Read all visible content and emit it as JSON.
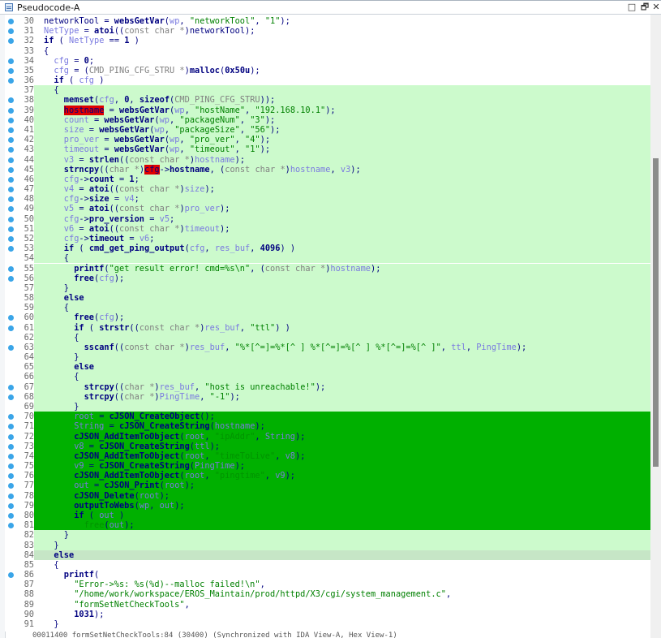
{
  "window": {
    "title": "Pseudocode-A",
    "buttons": {
      "maximize": "□",
      "restore": "🗗",
      "close": "✕"
    }
  },
  "colors": {
    "breakpoint": "#3aa5e8",
    "highlight_light": "#ccfacc",
    "highlight_dark": "#00b000",
    "highlight_else": "#c6e6c6",
    "marker_red": "#e00000"
  },
  "lines": [
    {
      "num": "30",
      "bp": true,
      "hl": "",
      "html": "networkTool = <span class='f'>websGetVar</span>(<span class='v'>wp</span>, <span class='s'>\"networkTool\"</span>, <span class='s'>\"1\"</span>);",
      "indent": 0
    },
    {
      "num": "31",
      "bp": true,
      "hl": "",
      "html": "<span class='v'>NetType</span> = <span class='f'>atoi</span>((<span class='t'>const char *</span>)networkTool);",
      "indent": 0
    },
    {
      "num": "32",
      "bp": true,
      "hl": "",
      "html": "<span class='k'>if</span> ( <span class='v'>NetType</span> == <span class='n'>1</span> )",
      "indent": 0
    },
    {
      "num": "33",
      "bp": false,
      "hl": "",
      "html": "{",
      "indent": 0
    },
    {
      "num": "34",
      "bp": true,
      "hl": "",
      "html": "<span class='v'>cfg</span> = <span class='n'>0</span>;",
      "indent": 1
    },
    {
      "num": "35",
      "bp": true,
      "hl": "",
      "html": "<span class='v'>cfg</span> = (<span class='t'>CMD_PING_CFG_STRU *</span>)<span class='f'>malloc</span>(<span class='n'>0x50u</span>);",
      "indent": 1
    },
    {
      "num": "36",
      "bp": true,
      "hl": "",
      "html": "<span class='k'>if</span> ( <span class='v'>cfg</span> )",
      "indent": 1
    },
    {
      "num": "37",
      "bp": false,
      "hl": "light",
      "html": "{",
      "indent": 1
    },
    {
      "num": "38",
      "bp": true,
      "hl": "light",
      "html": "<span class='f'>memset</span>(<span class='v'>cfg</span>, <span class='n'>0</span>, <span class='k'>sizeof</span>(<span class='t'>CMD_PING_CFG_STRU</span>));",
      "indent": 2
    },
    {
      "num": "39",
      "bp": true,
      "hl": "light",
      "html": "<span class='red'>hostname</span> = <span class='f'>websGetVar</span>(<span class='v'>wp</span>, <span class='s'>\"hostName\"</span>, <span class='s'>\"192.168.10.1\"</span>);",
      "indent": 2
    },
    {
      "num": "40",
      "bp": true,
      "hl": "light",
      "html": "<span class='v'>count</span> = <span class='f'>websGetVar</span>(<span class='v'>wp</span>, <span class='s'>\"packageNum\"</span>, <span class='s'>\"3\"</span>);",
      "indent": 2
    },
    {
      "num": "41",
      "bp": true,
      "hl": "light",
      "html": "<span class='v'>size</span> = <span class='f'>websGetVar</span>(<span class='v'>wp</span>, <span class='s'>\"packageSize\"</span>, <span class='s'>\"56\"</span>);",
      "indent": 2
    },
    {
      "num": "42",
      "bp": true,
      "hl": "light",
      "html": "<span class='v'>pro_ver</span> = <span class='f'>websGetVar</span>(<span class='v'>wp</span>, <span class='s'>\"pro_ver\"</span>, <span class='s'>\"4\"</span>);",
      "indent": 2
    },
    {
      "num": "43",
      "bp": true,
      "hl": "light",
      "html": "<span class='v'>timeout</span> = <span class='f'>websGetVar</span>(<span class='v'>wp</span>, <span class='s'>\"timeout\"</span>, <span class='s'>\"1\"</span>);",
      "indent": 2
    },
    {
      "num": "44",
      "bp": true,
      "hl": "light",
      "html": "<span class='v'>v3</span> = <span class='f'>strlen</span>((<span class='t'>const char *</span>)<span class='v'>hostname</span>);",
      "indent": 2
    },
    {
      "num": "45",
      "bp": true,
      "hl": "light",
      "html": "<span class='f'>strncpy</span>((<span class='t'>char *</span>)<span class='red'>cfg</span>-><span class='n'>hostname</span>, (<span class='t'>const char *</span>)<span class='v'>hostname</span>, <span class='v'>v3</span>);",
      "indent": 2
    },
    {
      "num": "46",
      "bp": true,
      "hl": "light",
      "html": "<span class='v'>cfg</span>-><span class='n'>count</span> = <span class='n'>1</span>;",
      "indent": 2
    },
    {
      "num": "47",
      "bp": true,
      "hl": "light",
      "html": "<span class='v'>v4</span> = <span class='f'>atoi</span>((<span class='t'>const char *</span>)<span class='v'>size</span>);",
      "indent": 2
    },
    {
      "num": "48",
      "bp": true,
      "hl": "light",
      "html": "<span class='v'>cfg</span>-><span class='n'>size</span> = <span class='v'>v4</span>;",
      "indent": 2
    },
    {
      "num": "49",
      "bp": true,
      "hl": "light",
      "html": "<span class='v'>v5</span> = <span class='f'>atoi</span>((<span class='t'>const char *</span>)<span class='v'>pro_ver</span>);",
      "indent": 2
    },
    {
      "num": "50",
      "bp": true,
      "hl": "light",
      "html": "<span class='v'>cfg</span>-><span class='n'>pro_version</span> = <span class='v'>v5</span>;",
      "indent": 2
    },
    {
      "num": "51",
      "bp": true,
      "hl": "light",
      "html": "<span class='v'>v6</span> = <span class='f'>atoi</span>((<span class='t'>const char *</span>)<span class='v'>timeout</span>);",
      "indent": 2
    },
    {
      "num": "52",
      "bp": true,
      "hl": "light",
      "html": "<span class='v'>cfg</span>-><span class='n'>timeout</span> = <span class='v'>v6</span>;",
      "indent": 2
    },
    {
      "num": "53",
      "bp": true,
      "hl": "light",
      "html": "<span class='k'>if</span> ( <span class='f'>cmd_get_ping_output</span>(<span class='v'>cfg</span>, <span class='v'>res_buf</span>, <span class='n'>4096</span>) )",
      "indent": 2
    },
    {
      "num": "54",
      "bp": false,
      "hl": "light",
      "html": "{",
      "indent": 2
    },
    {
      "num": "55",
      "bp": true,
      "hl": "light",
      "html": "<span class='f'>printf</span>(<span class='s'>\"get result error! cmd=%s\\n\"</span>, (<span class='t'>const char *</span>)<span class='v'>hostname</span>);",
      "indent": 3
    },
    {
      "num": "56",
      "bp": true,
      "hl": "light",
      "html": "<span class='f'>free</span>(<span class='v'>cfg</span>);",
      "indent": 3
    },
    {
      "num": "57",
      "bp": false,
      "hl": "light",
      "html": "}",
      "indent": 2
    },
    {
      "num": "58",
      "bp": false,
      "hl": "light",
      "html": "<span class='k'>else</span>",
      "indent": 2
    },
    {
      "num": "59",
      "bp": false,
      "hl": "light",
      "html": "{",
      "indent": 2
    },
    {
      "num": "60",
      "bp": true,
      "hl": "light",
      "html": "<span class='f'>free</span>(<span class='v'>cfg</span>);",
      "indent": 3
    },
    {
      "num": "61",
      "bp": true,
      "hl": "light",
      "html": "<span class='k'>if</span> ( <span class='f'>strstr</span>((<span class='t'>const char *</span>)<span class='v'>res_buf</span>, <span class='s'>\"ttl\"</span>) )",
      "indent": 3
    },
    {
      "num": "62",
      "bp": false,
      "hl": "light",
      "html": "{",
      "indent": 3
    },
    {
      "num": "63",
      "bp": true,
      "hl": "light",
      "html": "<span class='f'>sscanf</span>((<span class='t'>const char *</span>)<span class='v'>res_buf</span>, <span class='s'>\"%*[^=]=%*[^ ] %*[^=]=%[^ ] %*[^=]=%[^ ]\"</span>, <span class='v'>ttl</span>, <span class='v'>PingTime</span>);",
      "indent": 4
    },
    {
      "num": "64",
      "bp": false,
      "hl": "light",
      "html": "}",
      "indent": 3
    },
    {
      "num": "65",
      "bp": false,
      "hl": "light",
      "html": "<span class='k'>else</span>",
      "indent": 3
    },
    {
      "num": "66",
      "bp": false,
      "hl": "light",
      "html": "{",
      "indent": 3
    },
    {
      "num": "67",
      "bp": true,
      "hl": "light",
      "html": "<span class='f'>strcpy</span>((<span class='t'>char *</span>)<span class='v'>res_buf</span>, <span class='s'>\"host is unreachable!\"</span>);",
      "indent": 4
    },
    {
      "num": "68",
      "bp": true,
      "hl": "light",
      "html": "<span class='f'>strcpy</span>((<span class='t'>char *</span>)<span class='v'>PingTime</span>, <span class='s'>\"-1\"</span>);",
      "indent": 4
    },
    {
      "num": "69",
      "bp": false,
      "hl": "light",
      "html": "}",
      "indent": 3
    },
    {
      "num": "70",
      "bp": true,
      "hl": "dark",
      "html": "<span class='v'>root</span> = <span class='f'>cJSON_CreateObject</span>();",
      "indent": 3
    },
    {
      "num": "71",
      "bp": true,
      "hl": "dark",
      "html": "<span class='v'>String</span> = <span class='f'>cJSON_CreateString</span>(<span class='v'>hostname</span>);",
      "indent": 3
    },
    {
      "num": "72",
      "bp": true,
      "hl": "dark",
      "html": "<span class='f'>cJSON_AddItemToObject</span>(<span class='v'>root</span>, <span class='s'>\"ipAddr\"</span>, <span class='v'>String</span>);",
      "indent": 3
    },
    {
      "num": "73",
      "bp": true,
      "hl": "dark",
      "html": "<span class='v'>v8</span> = <span class='f'>cJSON_CreateString</span>(<span class='v'>ttl</span>);",
      "indent": 3
    },
    {
      "num": "74",
      "bp": true,
      "hl": "dark",
      "html": "<span class='f'>cJSON_AddItemToObject</span>(<span class='v'>root</span>, <span class='s'>\"timeToLive\"</span>, <span class='v'>v8</span>);",
      "indent": 3
    },
    {
      "num": "75",
      "bp": true,
      "hl": "dark",
      "html": "<span class='v'>v9</span> = <span class='f'>cJSON_CreateString</span>(<span class='v'>PingTime</span>);",
      "indent": 3
    },
    {
      "num": "76",
      "bp": true,
      "hl": "dark",
      "html": "<span class='f'>cJSON_AddItemToObject</span>(<span class='v'>root</span>, <span class='s'>\"pingtime\"</span>, <span class='v'>v9</span>);",
      "indent": 3
    },
    {
      "num": "77",
      "bp": true,
      "hl": "dark",
      "html": "<span class='v'>out</span> = <span class='f'>cJSON_Print</span>(<span class='v'>root</span>);",
      "indent": 3
    },
    {
      "num": "78",
      "bp": true,
      "hl": "dark",
      "html": "<span class='f'>cJSON_Delete</span>(<span class='v'>root</span>);",
      "indent": 3
    },
    {
      "num": "79",
      "bp": true,
      "hl": "dark",
      "html": "<span class='f'>outputToWebs</span>(<span class='v'>wp</span>, <span class='v'>out</span>);",
      "indent": 3
    },
    {
      "num": "80",
      "bp": true,
      "hl": "dark",
      "html": "<span class='k'>if</span> ( <span class='v'>out</span> )",
      "indent": 3
    },
    {
      "num": "81",
      "bp": true,
      "hl": "dark",
      "html": "<span class='s'>free</span>(<span class='v'>out</span>);",
      "indent": 4
    },
    {
      "num": "82",
      "bp": false,
      "hl": "light",
      "html": "}",
      "indent": 2
    },
    {
      "num": "83",
      "bp": false,
      "hl": "light",
      "html": "}",
      "indent": 1
    },
    {
      "num": "84",
      "bp": false,
      "hl": "else",
      "html": "<span class='k'>else</span>",
      "indent": 1
    },
    {
      "num": "85",
      "bp": false,
      "hl": "",
      "html": "{",
      "indent": 1
    },
    {
      "num": "86",
      "bp": true,
      "hl": "",
      "html": "<span class='f'>printf</span>(",
      "indent": 2
    },
    {
      "num": "87",
      "bp": false,
      "hl": "",
      "html": "<span class='s'>\"Error->%s: %s(%d)--malloc failed!\\n\"</span>,",
      "indent": 3
    },
    {
      "num": "88",
      "bp": false,
      "hl": "",
      "html": "<span class='s'>\"/home/work/workspace/EROS_Maintain/prod/httpd/X3/cgi/system_management.c\"</span>,",
      "indent": 3
    },
    {
      "num": "89",
      "bp": false,
      "hl": "",
      "html": "<span class='s'>\"formSetNetCheckTools\"</span>,",
      "indent": 3
    },
    {
      "num": "90",
      "bp": false,
      "hl": "",
      "html": "<span class='n'>1031</span>);",
      "indent": 3
    },
    {
      "num": "91",
      "bp": false,
      "hl": "",
      "html": "}",
      "indent": 1
    }
  ],
  "statusbar": {
    "text": "00011400 formSetNetCheckTools:84 (30400) (Synchronized with IDA View-A, Hex View-1)"
  },
  "scroll": {
    "position_fraction": 0.23,
    "visible_fraction": 0.49
  }
}
